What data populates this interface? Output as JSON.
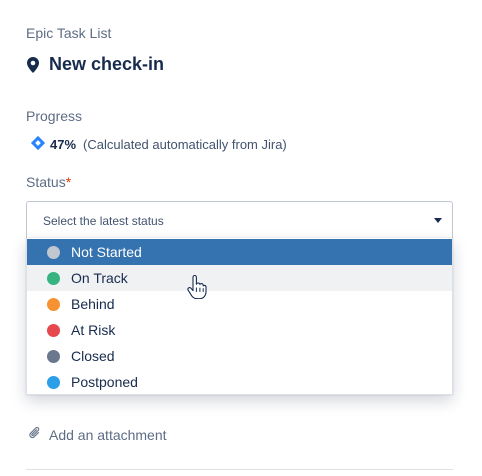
{
  "breadcrumb": "Epic Task List",
  "header": {
    "icon": "location-pin-icon",
    "title": "New check-in"
  },
  "progress": {
    "label": "Progress",
    "icon": "jira-diamond-icon",
    "percent_text": "47%",
    "note": "(Calculated automatically from Jira)"
  },
  "status": {
    "label": "Status",
    "required_marker": "*",
    "placeholder": "Select the latest status",
    "options": [
      {
        "label": "Not Started",
        "color": "#c1c7d0"
      },
      {
        "label": "On Track",
        "color": "#36b37e"
      },
      {
        "label": "Behind",
        "color": "#f79232"
      },
      {
        "label": "At Risk",
        "color": "#e5484d"
      },
      {
        "label": "Closed",
        "color": "#6b778c"
      },
      {
        "label": "Postponed",
        "color": "#2d9ee8"
      }
    ],
    "highlighted_option": "Not Started",
    "hovered_option": "On Track"
  },
  "attachment": {
    "label": "Add an attachment",
    "icon": "paperclip-icon"
  },
  "colors": {
    "accent": "#3572b0",
    "jira_blue": "#2684ff",
    "required": "#de350b"
  }
}
